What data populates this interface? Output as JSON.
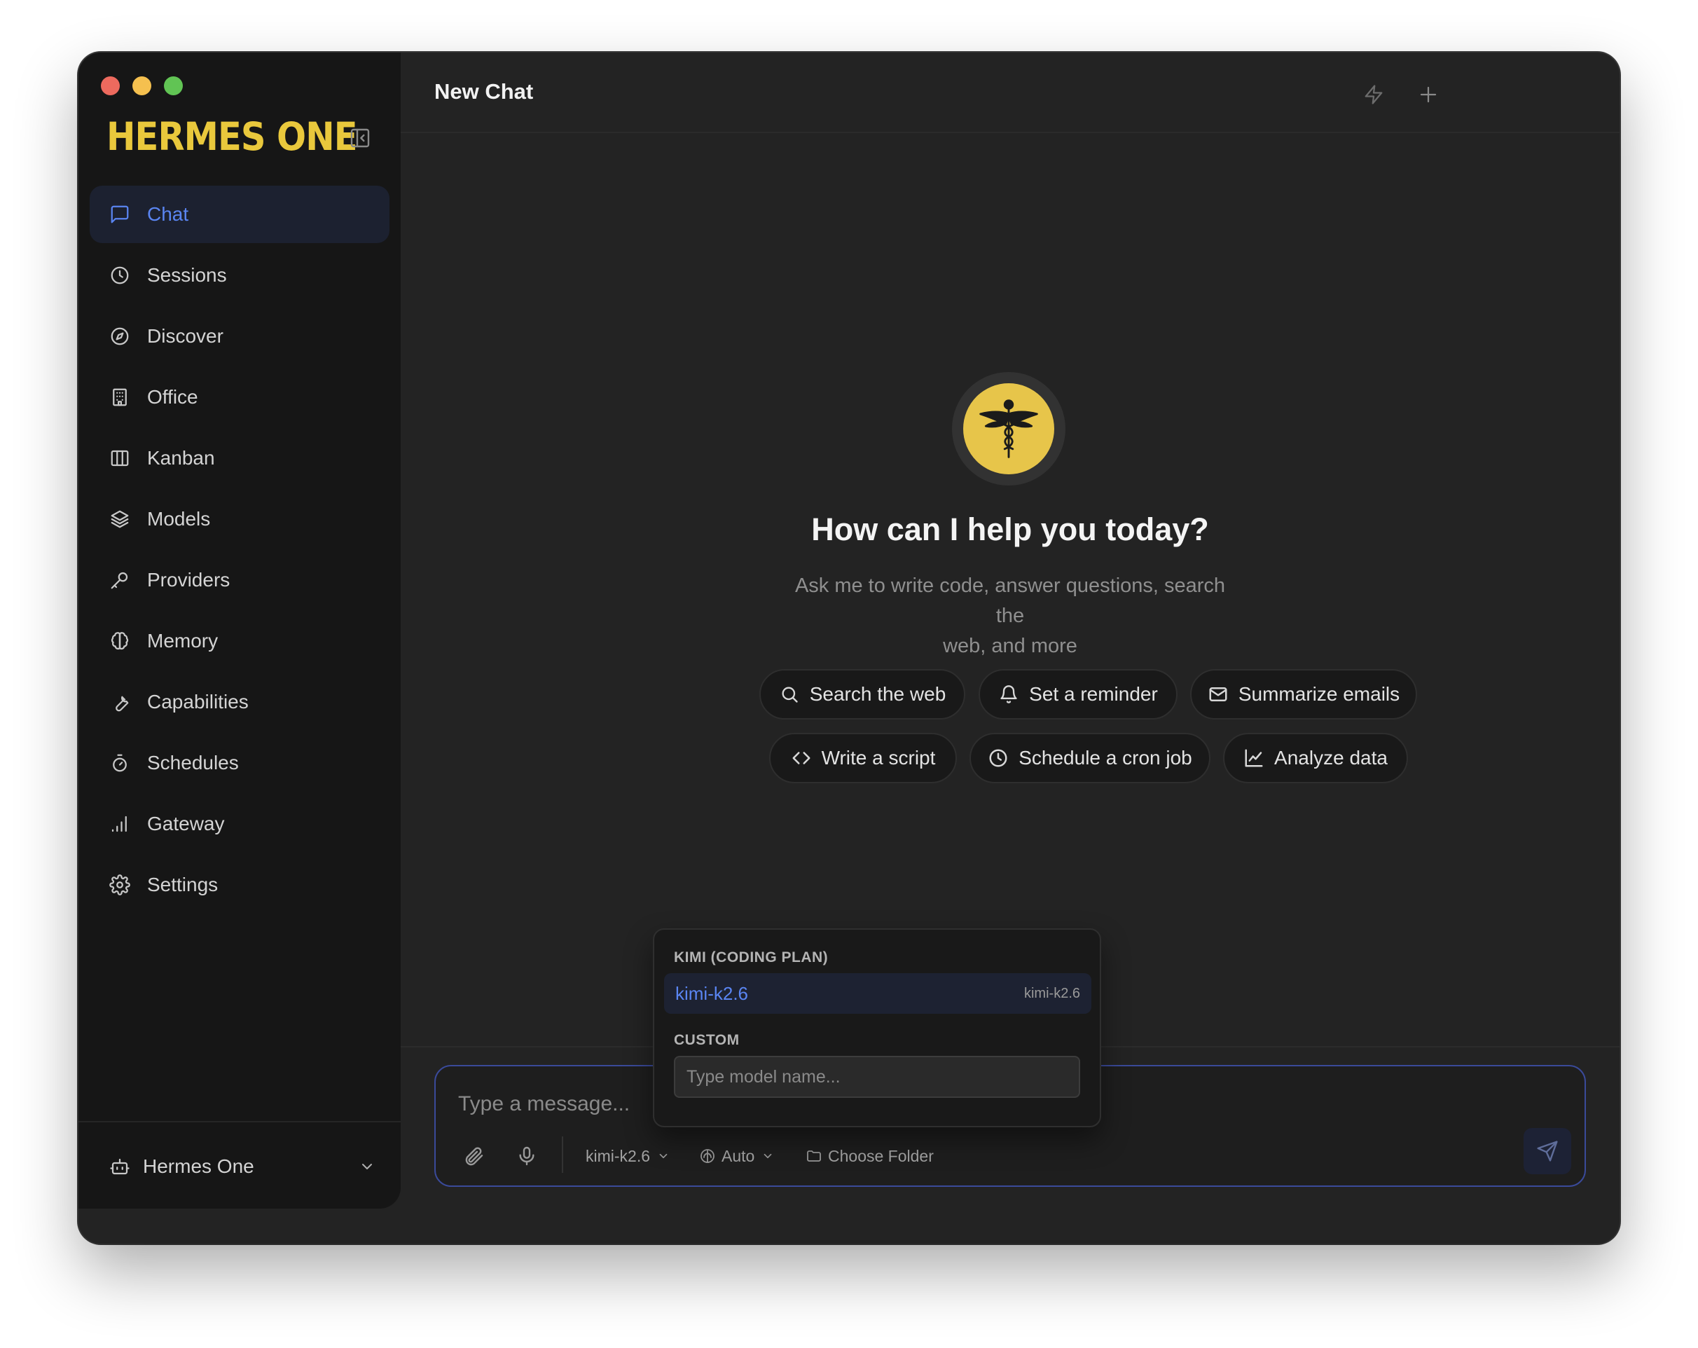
{
  "app": {
    "logo": "HERMES ONE"
  },
  "sidebar": {
    "items": [
      {
        "label": "Chat",
        "icon": "message-square-icon",
        "active": true
      },
      {
        "label": "Sessions",
        "icon": "clock-icon"
      },
      {
        "label": "Discover",
        "icon": "compass-icon"
      },
      {
        "label": "Office",
        "icon": "building-icon"
      },
      {
        "label": "Kanban",
        "icon": "columns-icon"
      },
      {
        "label": "Models",
        "icon": "layers-icon"
      },
      {
        "label": "Providers",
        "icon": "key-icon"
      },
      {
        "label": "Memory",
        "icon": "brain-icon"
      },
      {
        "label": "Capabilities",
        "icon": "wrench-icon"
      },
      {
        "label": "Schedules",
        "icon": "timer-icon"
      },
      {
        "label": "Gateway",
        "icon": "signal-bars-icon"
      },
      {
        "label": "Settings",
        "icon": "gear-icon"
      }
    ],
    "footer": {
      "label": "Hermes One",
      "icon": "bot-icon"
    }
  },
  "header": {
    "title": "New Chat"
  },
  "hero": {
    "title": "How can I help you today?",
    "subtitle_line1": "Ask me to write code, answer questions, search the",
    "subtitle_line2": "web, and more"
  },
  "suggestions": [
    {
      "label": "Search the web",
      "icon": "search-icon"
    },
    {
      "label": "Set a reminder",
      "icon": "bell-icon"
    },
    {
      "label": "Summarize emails",
      "icon": "mail-icon"
    },
    {
      "label": "Write a script",
      "icon": "code-icon"
    },
    {
      "label": "Schedule a cron job",
      "icon": "clock-icon"
    },
    {
      "label": "Analyze data",
      "icon": "line-chart-icon"
    }
  ],
  "composer": {
    "placeholder": "Type a message...",
    "model": "kimi-k2.6",
    "mode": "Auto",
    "folder": "Choose Folder"
  },
  "model_popup": {
    "group_label": "KIMI (CODING PLAN)",
    "item_name": "kimi-k2.6",
    "item_tag": "kimi-k2.6",
    "custom_label": "CUSTOM",
    "custom_placeholder": "Type model name..."
  },
  "colors": {
    "accent": "#5a85f2",
    "brand": "#e9c83c",
    "background": "#232323",
    "sidebar": "#161616"
  }
}
